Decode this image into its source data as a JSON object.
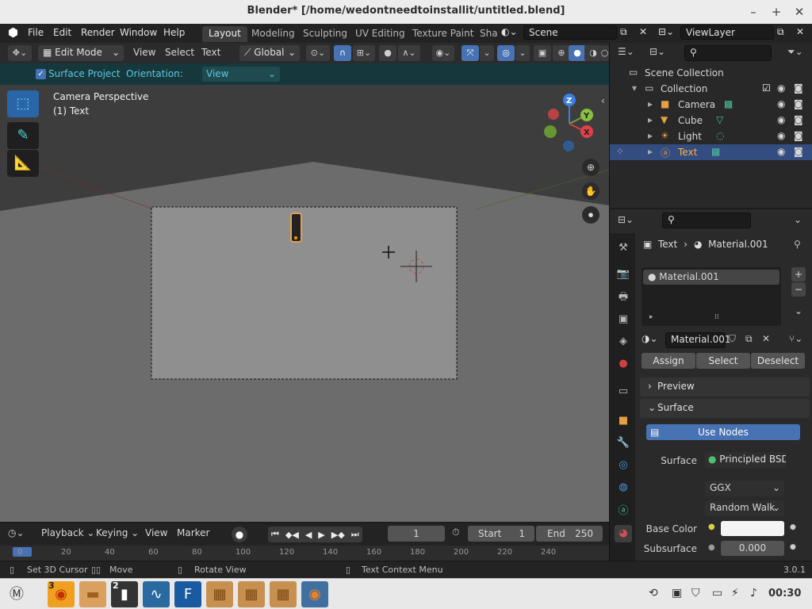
{
  "window": {
    "title": "Blender* [/home/wedontneedtoinstallit/untitled.blend]",
    "minimize": "–",
    "maximize": "+",
    "close": "✕"
  },
  "menubar": {
    "logo": "⬢",
    "items": [
      "File",
      "Edit",
      "Render",
      "Window",
      "Help"
    ],
    "workspaces": [
      "Layout",
      "Modeling",
      "Sculpting",
      "UV Editing",
      "Texture Paint",
      "Sha"
    ],
    "scene": "Scene",
    "view_layer": "ViewLayer"
  },
  "viewport_header": {
    "mode": "Edit Mode",
    "menus": [
      "View",
      "Select",
      "Text"
    ],
    "orientation": "Global"
  },
  "tool_settings": {
    "surface_project": "Surface Project",
    "orientation_label": "Orientation:",
    "orientation_value": "View"
  },
  "viewport": {
    "camera_label": "Camera Perspective",
    "object_label": "(1) Text",
    "gizmo": {
      "z": "Z",
      "y": "Y",
      "x": "X"
    }
  },
  "outliner": {
    "search_placeholder": "",
    "scene_collection": "Scene Collection",
    "collection": "Collection",
    "objects": [
      "Camera",
      "Cube",
      "Light",
      "Text"
    ]
  },
  "properties": {
    "breadcrumb_object": "Text",
    "breadcrumb_material": "Material.001",
    "slot_name": "Material.001",
    "material_name": "Material.001",
    "assign": "Assign",
    "select": "Select",
    "deselect": "Deselect",
    "preview": "Preview",
    "surface_panel": "Surface",
    "use_nodes": "Use Nodes",
    "surface_label": "Surface",
    "surface_value": "Principled BSDF",
    "distribution": "GGX",
    "subsurface_method": "Random Walk",
    "base_color_label": "Base Color",
    "subsurface_label": "Subsurface",
    "subsurface_value": "0.000"
  },
  "timeline": {
    "menus": [
      "Playback",
      "Keying",
      "View",
      "Marker"
    ],
    "current_frame": "1",
    "start_label": "Start",
    "start_value": "1",
    "end_label": "End",
    "end_value": "250",
    "ruler": [
      "0",
      "20",
      "40",
      "60",
      "80",
      "100",
      "120",
      "140",
      "160",
      "180",
      "200",
      "220",
      "240"
    ]
  },
  "statusbar": {
    "set_cursor": "Set 3D Cursor",
    "move": "Move",
    "rotate": "Rotate View",
    "context_menu": "Text Context Menu",
    "version": "3.0.1"
  },
  "taskbar": {
    "firefox_badge": "3",
    "terminal_badge": "2",
    "clock": "00:30"
  },
  "colors": {
    "accent": "#4772b3",
    "tool_header": "#16383d",
    "selected_row": "#334d80"
  }
}
